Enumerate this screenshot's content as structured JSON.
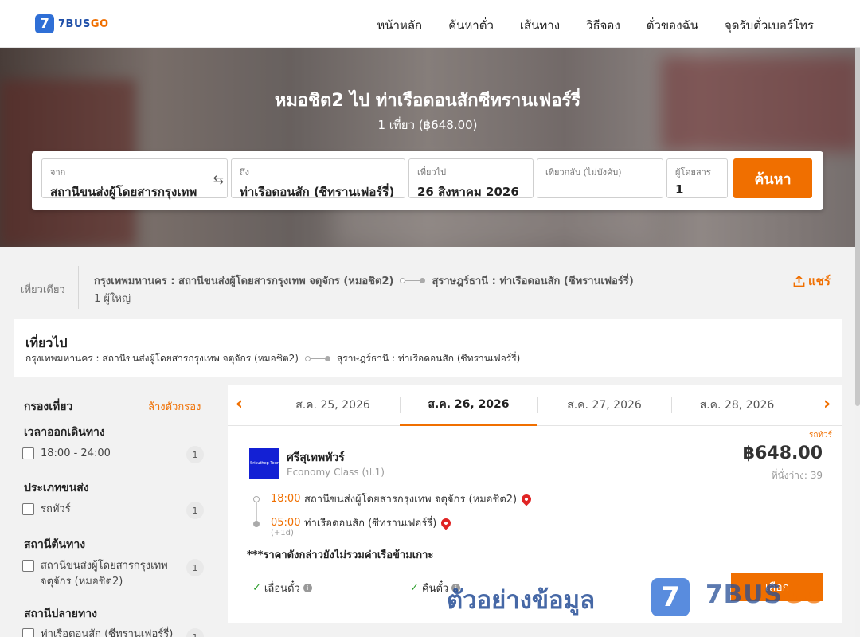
{
  "header": {
    "logo_number": "7",
    "logo_brand": "7BUS",
    "logo_brand_accent": "GO",
    "nav": [
      "หน้าหลัก",
      "ค้นหาตั๋ว",
      "เส้นทาง",
      "วิธีจอง",
      "ตั๋วของฉัน",
      "จุดรับตั๋วเบอร์โทร"
    ]
  },
  "hero": {
    "title": "หมอชิต2 ไป ท่าเรือดอนสักซีทรานเฟอร์รี่",
    "subtitle": "1 เที่ยว (฿648.00)"
  },
  "search": {
    "from_label": "จาก",
    "from_value": "สถานีขนส่งผู้โดยสารกรุงเทพ",
    "to_label": "ถึง",
    "to_value": "ท่าเรือดอนสัก (ซีทรานเฟอร์รี่)",
    "depart_label": "เที่ยวไป",
    "depart_value": "26 สิงหาคม 2026",
    "return_label": "เที่ยวกลับ (ไม่บังคับ)",
    "return_value": "",
    "pax_label": "ผู้โดยสาร",
    "pax_value": "1",
    "button": "ค้นหา"
  },
  "summary": {
    "trip_type": "เที่ยวเดียว",
    "origin": "กรุงเทพมหานคร : สถานีขนส่งผู้โดยสารกรุงเทพ จตุจักร (หมอชิต2)",
    "destination": "สุราษฎร์ธานี : ท่าเรือดอนสัก (ซีทรานเฟอร์รี่)",
    "passengers": "1 ผู้ใหญ่",
    "share": "แชร์"
  },
  "outbound": {
    "heading": "เที่ยวไป",
    "origin": "กรุงเทพมหานคร : สถานีขนส่งผู้โดยสารกรุงเทพ จตุจักร (หมอชิต2)",
    "destination": "สุราษฎร์ธานี : ท่าเรือดอนสัก (ซีทรานเฟอร์รี่)"
  },
  "filters": {
    "title": "กรองเที่ยว",
    "clear": "ล้างตัวกรอง",
    "sections": [
      {
        "title": "เวลาออกเดินทาง",
        "items": [
          {
            "label": "18:00 - 24:00",
            "count": "1"
          }
        ]
      },
      {
        "title": "ประเภทขนส่ง",
        "items": [
          {
            "label": "รถทัวร์",
            "count": "1"
          }
        ]
      },
      {
        "title": "สถานีต้นทาง",
        "items": [
          {
            "label": "สถานีขนส่งผู้โดยสารกรุงเทพ จตุจักร (หมอชิต2)",
            "count": "1"
          }
        ]
      },
      {
        "title": "สถานีปลายทาง",
        "items": [
          {
            "label": "ท่าเรือดอนสัก (ซีทรานเฟอร์รี่)",
            "count": "1"
          }
        ]
      }
    ]
  },
  "dates": [
    "ส.ค. 25, 2026",
    "ส.ค. 26, 2026",
    "ส.ค. 27, 2026",
    "ส.ค. 28, 2026"
  ],
  "result": {
    "tag": "รถทัวร์",
    "operator_logo_text": "Srisuthep Tour",
    "operator": "ศรีสุเทพทัวร์",
    "class": "Economy Class (ป.1)",
    "price": "฿648.00",
    "seats": "ที่นั่งว่าง: 39",
    "depart_time": "18:00",
    "depart_station": "สถานีขนส่งผู้โดยสารกรุงเทพ จตุจักร (หมอชิต2)",
    "arrive_time": "05:00",
    "arrive_station": "ท่าเรือดอนสัก (ซีทรานเฟอร์รี่)",
    "arrive_offset": "(+1d)",
    "note": "***ราคาดังกล่าวยังไม่รวมค่าเรือข้ามเกาะ",
    "feature_1": "เลื่อนตั๋ว",
    "feature_2": "คืนตั๋ว",
    "select": "เลือก"
  },
  "watermark": {
    "text": "ตัวอย่างข้อมูล",
    "number": "7",
    "brand": "7BUS",
    "brand_accent": "GO"
  },
  "colors": {
    "accent": "#f06f00",
    "brand_blue": "#2f6fd6"
  }
}
